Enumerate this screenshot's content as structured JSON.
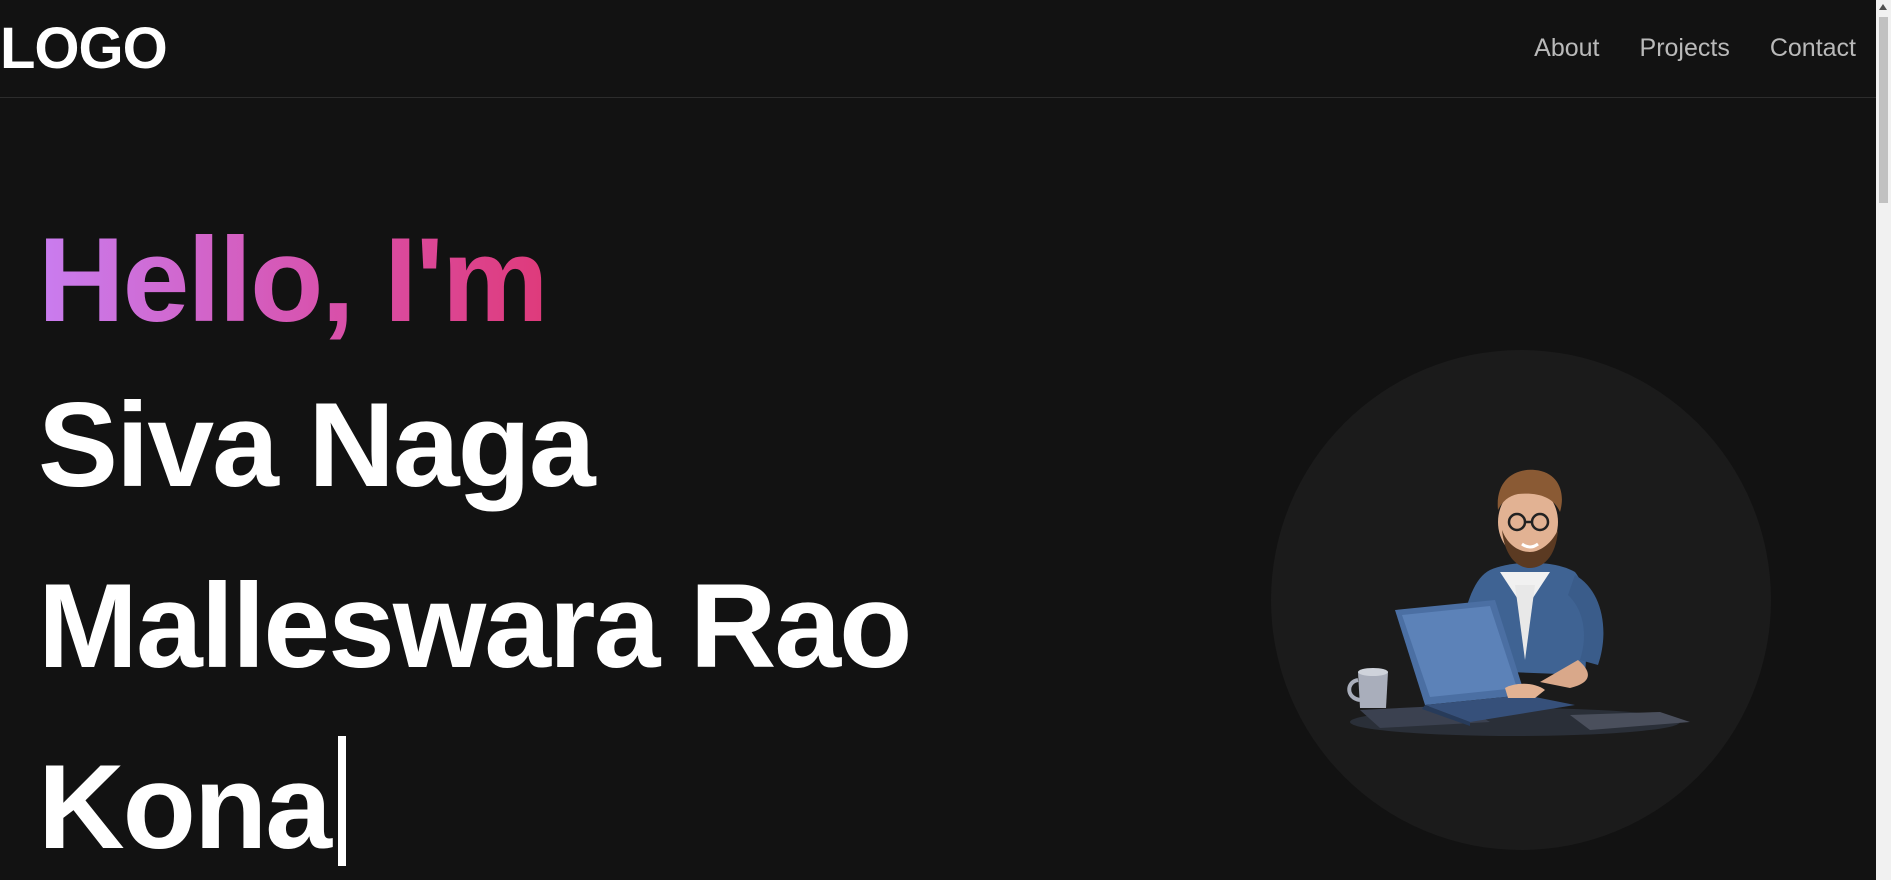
{
  "nav": {
    "logo": "LOGO",
    "links": [
      {
        "label": "About"
      },
      {
        "label": "Projects"
      },
      {
        "label": "Contact"
      }
    ]
  },
  "hero": {
    "greeting": "Hello, I'm",
    "name_lines": [
      "Siva Naga",
      "Malleswara Rao",
      "Kona"
    ]
  },
  "colors": {
    "background": "#121212",
    "gradient_start": "#c97df0",
    "gradient_end": "#e0356f",
    "text": "#ffffff",
    "nav_text": "#b9b9b9",
    "circle": "#1b1b1b"
  },
  "icons": {
    "avatar": "developer-with-laptop-illustration"
  }
}
